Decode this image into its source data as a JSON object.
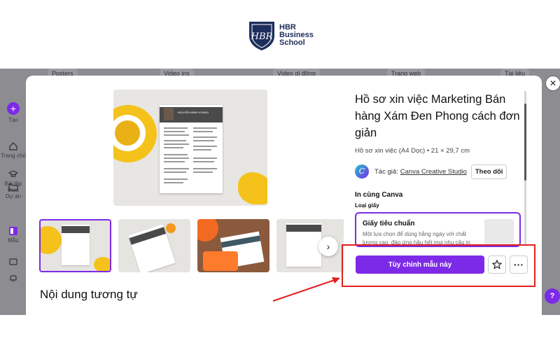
{
  "brand": {
    "line1": "HBR",
    "line2": "Business",
    "line3": "School",
    "monogram": "HBR"
  },
  "sidebar": {
    "items": [
      {
        "label": "Tạo",
        "icon": "plus-icon"
      },
      {
        "label": "Trang chủ",
        "icon": "home-icon"
      },
      {
        "label": "Bài tập thực",
        "icon": "graduation-cap-icon"
      },
      {
        "label": "Dự án",
        "icon": "folder-icon"
      },
      {
        "label": "Mẫu",
        "icon": "template-icon"
      }
    ]
  },
  "background_tabs": [
    "Posters",
    "Video ins",
    "Video di động",
    "Trang web",
    "Tài liệu"
  ],
  "modal": {
    "title": "Hồ sơ xin việc Marketing Bán hàng Xám Đen Phong cách đơn giản",
    "subtitle": "Hồ sơ xin việc (A4 Dọc) • 21 × 29,7 cm",
    "author_label": "Tác giả:",
    "author_name": "Canva Creative Studio",
    "follow_label": "Theo dõi",
    "in_canva_label": "In cùng Canva",
    "paper_type_label": "Loại giấy",
    "paper_name": "Giấy tiêu chuẩn",
    "paper_desc": "Một lựa chọn để dùng hằng ngày với chất lượng cao, đáp ứng hầu hết mọi nhu cầu in",
    "cta_label": "Tùy chỉnh mẫu này",
    "similar_label": "Nội dung tương tự",
    "canva_logo_letter": "C",
    "resume_name": "NGUYỄN MINH HOÀNG"
  },
  "icons": {
    "close": "close-icon",
    "next": "chevron-right-icon",
    "star": "star-icon",
    "more": "more-icon",
    "help": "help-icon"
  },
  "colors": {
    "accent": "#7d2ae8",
    "highlight": "#e02020",
    "brand": "#1d2d5c"
  },
  "help_label": "?"
}
